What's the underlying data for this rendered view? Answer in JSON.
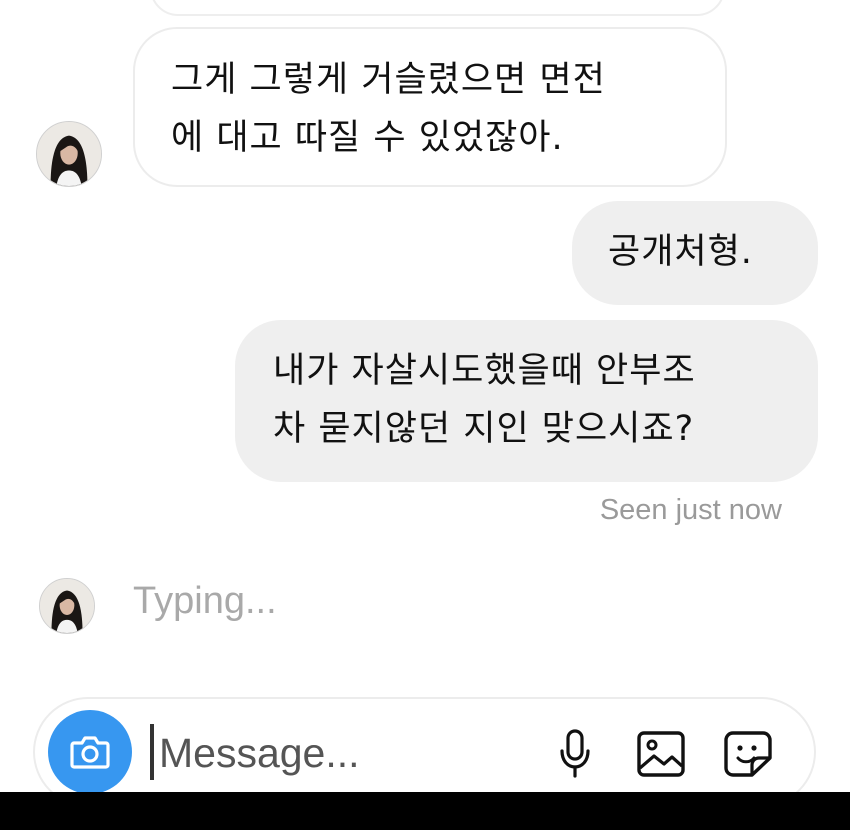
{
  "chat": {
    "messages": [
      {
        "direction": "incoming",
        "lines": [
          "그게 그렇게 거슬렸으면 면전",
          "에 대고 따질 수 있었잖아."
        ]
      },
      {
        "direction": "outgoing",
        "lines": [
          "공개처형."
        ]
      },
      {
        "direction": "outgoing",
        "lines": [
          "내가 자살시도했을때 안부조",
          "차 묻지않던 지인 맞으시죠?"
        ]
      }
    ],
    "seen_status": "Seen just now",
    "typing_indicator": "Typing..."
  },
  "composer": {
    "placeholder": "Message...",
    "icons": [
      "camera-icon",
      "microphone-icon",
      "gallery-icon",
      "sticker-icon"
    ]
  },
  "colors": {
    "accent": "#3797f0",
    "outgoing_bubble": "#efefef",
    "incoming_border": "#ececec",
    "secondary_text": "#9a9a9a"
  }
}
